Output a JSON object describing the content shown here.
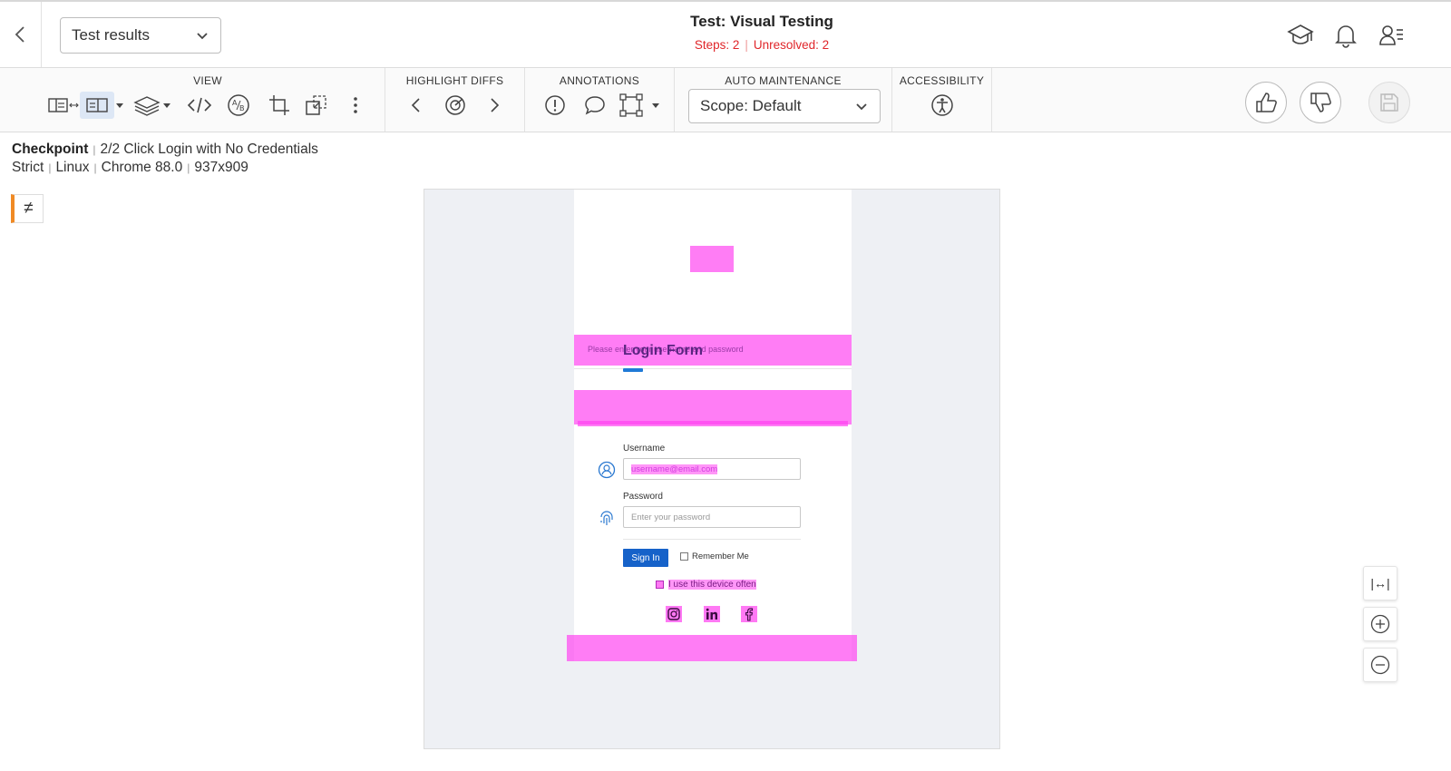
{
  "header": {
    "dropdown_value": "Test results",
    "title": "Test: Visual Testing",
    "steps": "Steps: 2",
    "unresolved": "Unresolved: 2",
    "icons": [
      "back-icon",
      "graduation-cap-icon",
      "bell-icon",
      "user-settings-icon"
    ]
  },
  "toolbar": {
    "groups": {
      "view": "VIEW",
      "highlight": "HIGHLIGHT DIFFS",
      "annotations": "ANNOTATIONS",
      "maintenance": "AUTO MAINTENANCE",
      "accessibility": "ACCESSIBILITY"
    },
    "view_icons": [
      "side-by-side-icon",
      "single-view-icon",
      "layers-icon",
      "code-icon",
      "ab-compare-icon",
      "crop-icon",
      "region-icon",
      "more-icon"
    ],
    "highlight_icons": [
      "prev-diff-icon",
      "target-icon",
      "next-diff-icon"
    ],
    "annotation_icons": [
      "issue-icon",
      "comment-icon",
      "region-select-icon"
    ],
    "scope_value": "Scope: Default",
    "actions": [
      "thumbs-up-icon",
      "thumbs-down-icon",
      "save-icon"
    ]
  },
  "checkpoint": {
    "label": "Checkpoint",
    "step": "2/2 Click Login with No Credentials",
    "match_level": "Strict",
    "os": "Linux",
    "browser": "Chrome 88.0",
    "size": "937x909",
    "diff_symbol": "≠"
  },
  "screenshot": {
    "login_title": "Login Form",
    "subtext": "Please enter your username and password",
    "username_label": "Username",
    "username_value": "username@email.com",
    "password_label": "Password",
    "password_placeholder": "Enter your password",
    "signin_label": "Sign In",
    "remember_label": "Remember Me",
    "device_label": "I use this device often",
    "diff_color": "#ff40f0"
  },
  "zoom": {
    "fit_label": "|↔|"
  }
}
